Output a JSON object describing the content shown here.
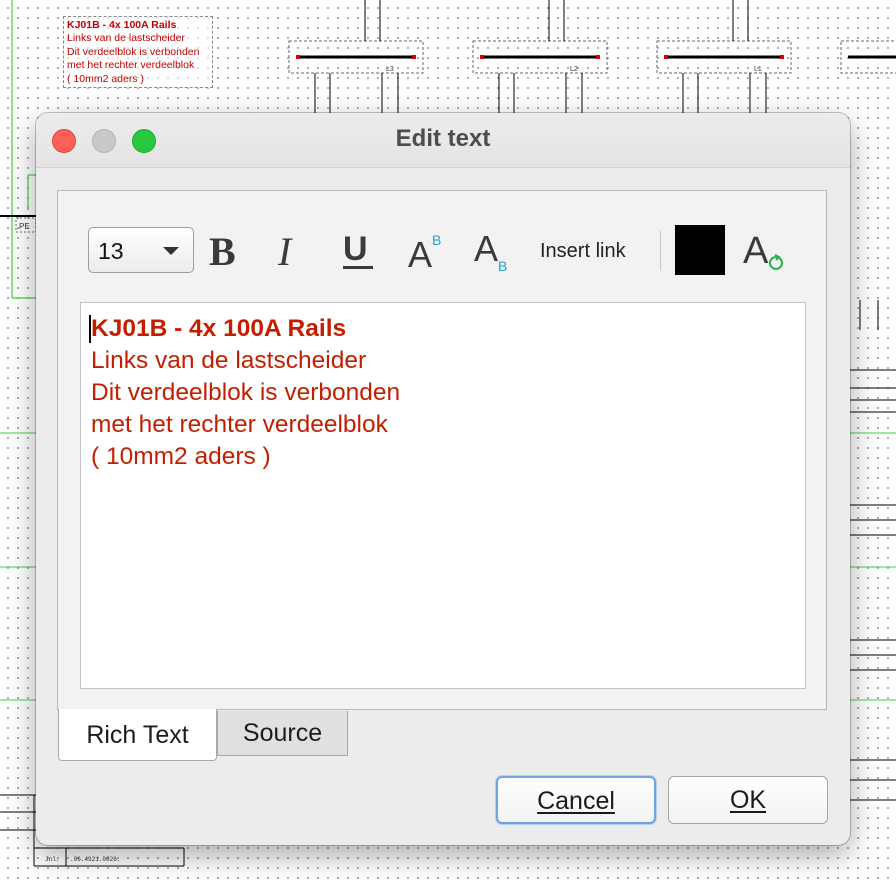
{
  "background": {
    "note_lines": [
      "KJ01B - 4x 100A Rails",
      "Links van de lastscheider",
      "Dit verdeelblok is verbonden",
      "met het rechter verdeelblok",
      "( 10mm2 aders )"
    ],
    "busbar_labels": [
      "L3",
      "L2",
      "L1"
    ],
    "pe_label": "PE",
    "footer_label": "Jnl.",
    "footer_code": ".06.4321.0026."
  },
  "dialog": {
    "title": "Edit text",
    "toolbar": {
      "font_size": "13",
      "bold_icon": "bold-icon",
      "italic_icon": "italic-icon",
      "underline_icon": "underline-icon",
      "superscript_icon": "superscript-icon",
      "subscript_icon": "subscript-icon",
      "insert_link": "Insert link",
      "text_color": "#000000",
      "reset_format_icon": "reset-format-icon"
    },
    "editor": {
      "lines": [
        "KJ01B - 4x 100A Rails",
        "Links van de lastscheider",
        "Dit verdeelblok is verbonden",
        "met het rechter verdeelblok",
        "( 10mm2 aders )"
      ],
      "text_color": "#c41e00"
    },
    "tabs": [
      "Rich Text",
      "Source"
    ],
    "buttons": {
      "cancel": "Cancel",
      "ok": "OK"
    }
  }
}
